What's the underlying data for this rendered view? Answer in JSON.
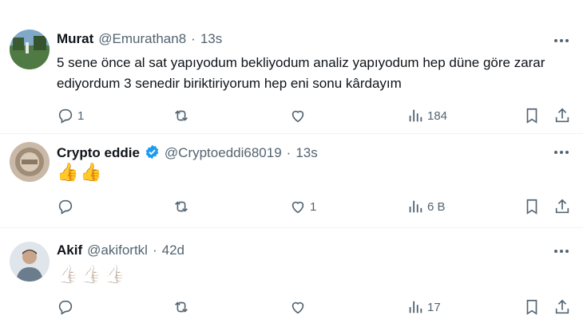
{
  "tweets": [
    {
      "name": "Murat",
      "handle": "@Emurathan8",
      "dot": "·",
      "time": "13s",
      "verified": false,
      "text": "5 sene önce al sat yapıyodum bekliyodum analiz yapıyodum hep düne göre zarar ediyordum 3 senedir biriktiriyorum hep eni sonu kârdayım",
      "emojis": [],
      "reply_count": "1",
      "retweet_count": "",
      "like_count": "",
      "view_count": "184"
    },
    {
      "name": "Crypto eddie",
      "handle": "@Cryptoeddi68019",
      "dot": "·",
      "time": "13s",
      "verified": true,
      "text": "",
      "emojis": [
        "👍",
        "👍"
      ],
      "reply_count": "",
      "retweet_count": "",
      "like_count": "1",
      "view_count": "6 B"
    },
    {
      "name": "Akif",
      "handle": "@akifortkl",
      "dot": "·",
      "time": "42d",
      "verified": false,
      "text": "",
      "emojis": [
        "👍🏻",
        "👍🏻",
        "👍🏻"
      ],
      "reply_count": "",
      "retweet_count": "",
      "like_count": "",
      "view_count": "17"
    }
  ],
  "icons": {
    "reply": "reply-icon",
    "retweet": "retweet-icon",
    "like": "like-icon",
    "views": "views-icon",
    "bookmark": "bookmark-icon",
    "share": "share-icon",
    "more": "more-icon",
    "verified": "verified-badge-icon"
  },
  "colors": {
    "text": "#0f1419",
    "secondary": "#536471",
    "verified_blue": "#1d9bf0",
    "divider": "#eff3f4"
  }
}
